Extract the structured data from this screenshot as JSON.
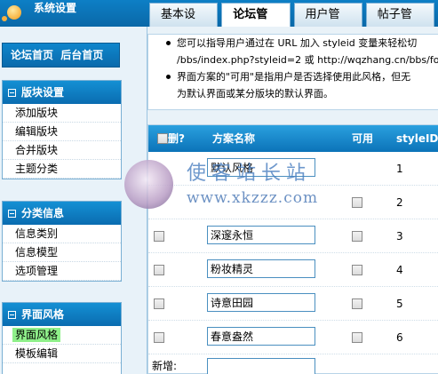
{
  "header": {
    "system_title": "系统设置",
    "tabs": [
      {
        "label": "基本设置",
        "active": false
      },
      {
        "label": "论坛管理",
        "active": true
      },
      {
        "label": "用户管理",
        "active": false
      },
      {
        "label": "帖子管理",
        "active": false
      }
    ]
  },
  "sidebar": {
    "home_links": [
      "论坛首页",
      "后台首页"
    ],
    "sections": [
      {
        "title": "版块设置",
        "items": [
          "添加版块",
          "编辑版块",
          "合并版块",
          "主题分类"
        ]
      },
      {
        "title": "分类信息",
        "items": [
          "信息类别",
          "信息模型",
          "选项管理"
        ]
      },
      {
        "title": "界面风格",
        "items": [
          "界面风格",
          "模板编辑"
        ],
        "current": "界面风格"
      }
    ]
  },
  "notes": [
    "您可以指导用户通过在 URL 加入 styleid 变量来轻松切",
    "/bbs/index.php?styleid=2 或 http://wqzhang.cn/bbs/fo",
    "界面方案的\"可用\"是指用户是否选择使用此风格，但无",
    "为默认界面或某分版块的默认界面。"
  ],
  "grid": {
    "headers": {
      "delete": "删?",
      "name": "方案名称",
      "available": "可用",
      "styleid": "styleID"
    },
    "rows": [
      {
        "name": "默认风格",
        "styleid": "1"
      },
      {
        "name": "",
        "styleid": "2"
      },
      {
        "name": "深邃永恒",
        "styleid": "3"
      },
      {
        "name": "粉妆精灵",
        "styleid": "4"
      },
      {
        "name": "诗意田园",
        "styleid": "5"
      },
      {
        "name": "春意盎然",
        "styleid": "6"
      }
    ],
    "new_label": "新增:"
  },
  "watermark": {
    "title": "使客站长站",
    "url": "www.xkzzz.com"
  },
  "colors": {
    "header_blue": "#0a68a8",
    "highlight_green": "#8ff08a"
  }
}
